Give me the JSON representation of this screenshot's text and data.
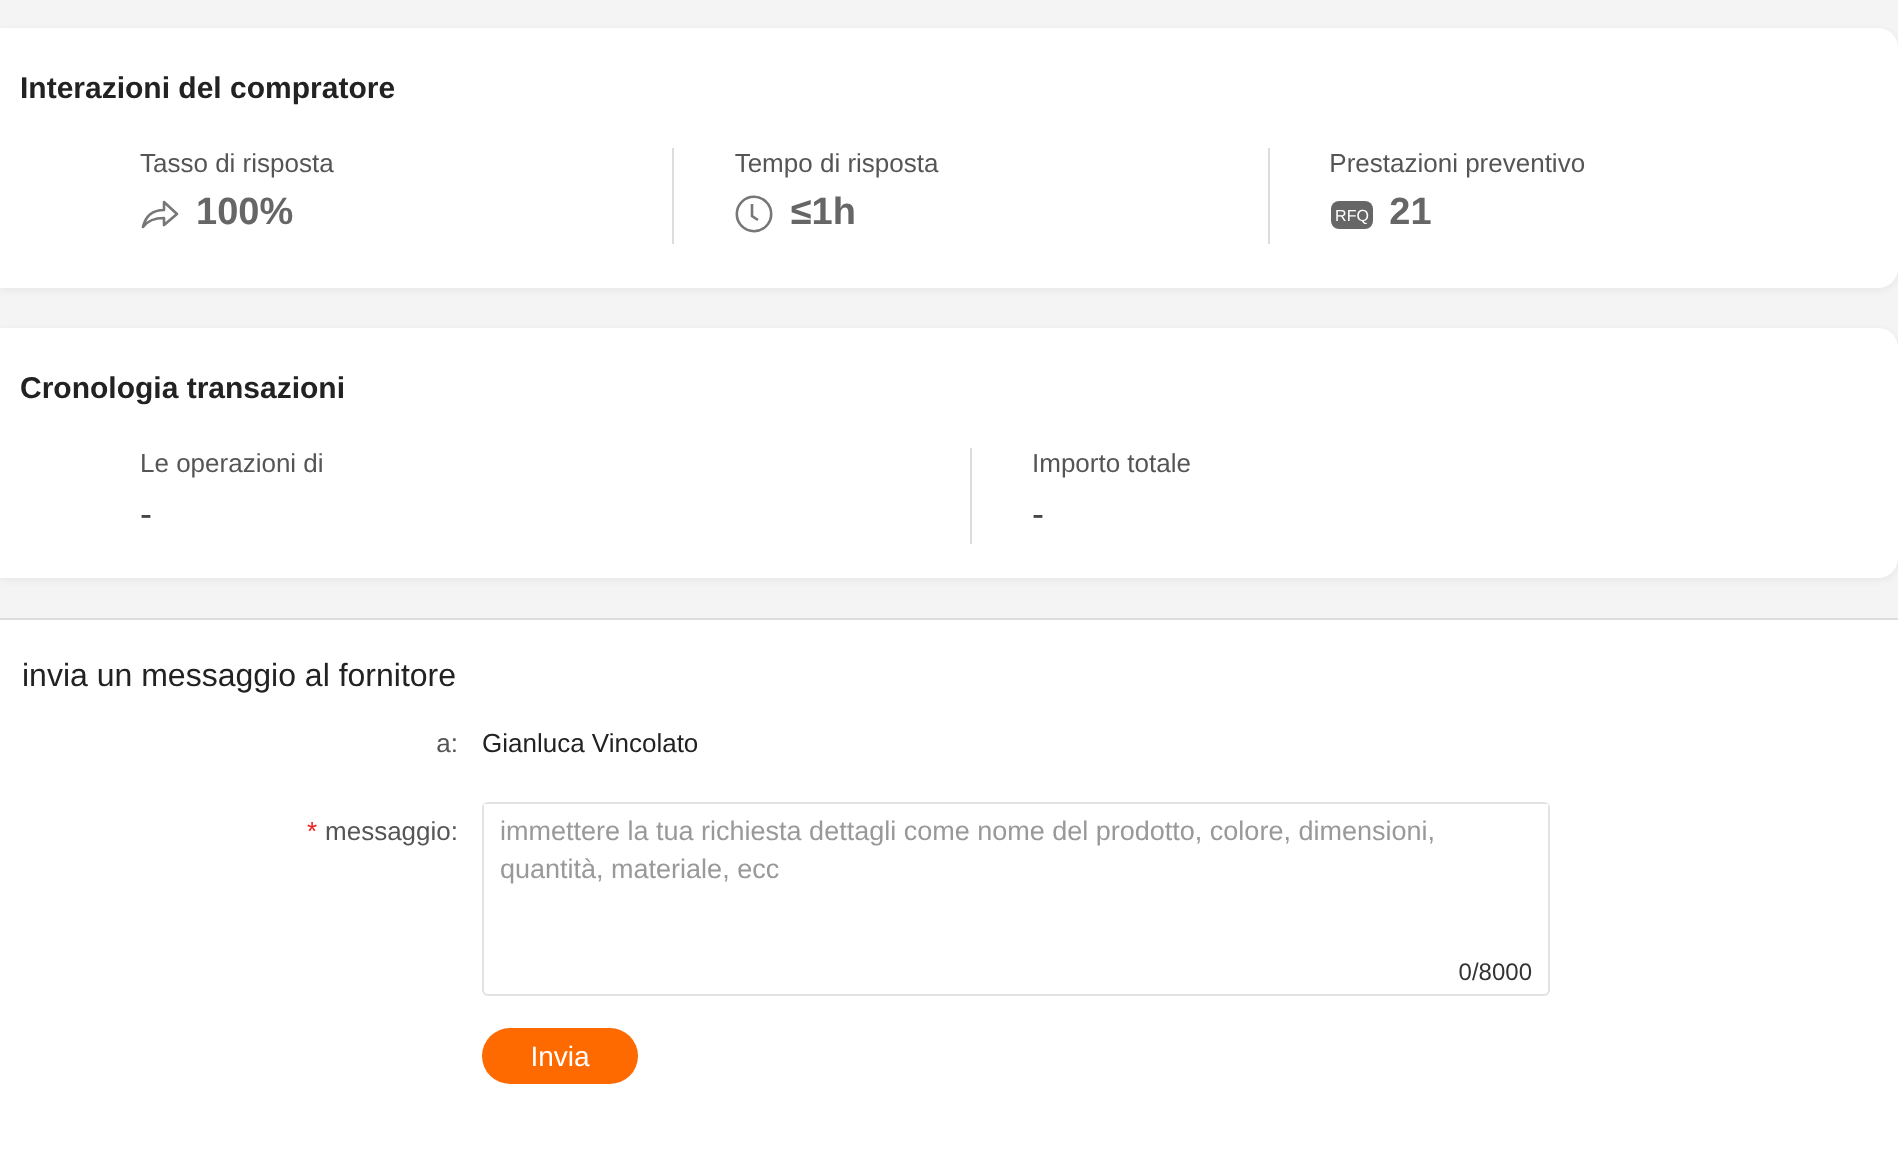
{
  "buyer_interactions": {
    "title": "Interazioni del compratore",
    "stats": [
      {
        "label": "Tasso di risposta",
        "value": "100%",
        "kind": "share"
      },
      {
        "label": "Tempo di risposta",
        "value": "≤1h",
        "kind": "clock"
      },
      {
        "label": "Prestazioni preventivo",
        "value": "21",
        "kind": "rfq",
        "icon_text": "RFQ"
      }
    ]
  },
  "transaction_history": {
    "title": "Cronologia transazioni",
    "stats": [
      {
        "label": "Le operazioni di",
        "value": "-"
      },
      {
        "label": "Importo totale",
        "value": "-"
      }
    ]
  },
  "message_form": {
    "title": "invia un messaggio al fornitore",
    "to_label": "a:",
    "to_value": "Gianluca Vincolato",
    "required_mark": "*",
    "message_label": "messaggio:",
    "placeholder": "immettere la tua richiesta dettagli come nome del prodotto, colore, dimensioni, quantità, materiale, ecc",
    "counter": "0/8000",
    "submit": "Invia"
  }
}
